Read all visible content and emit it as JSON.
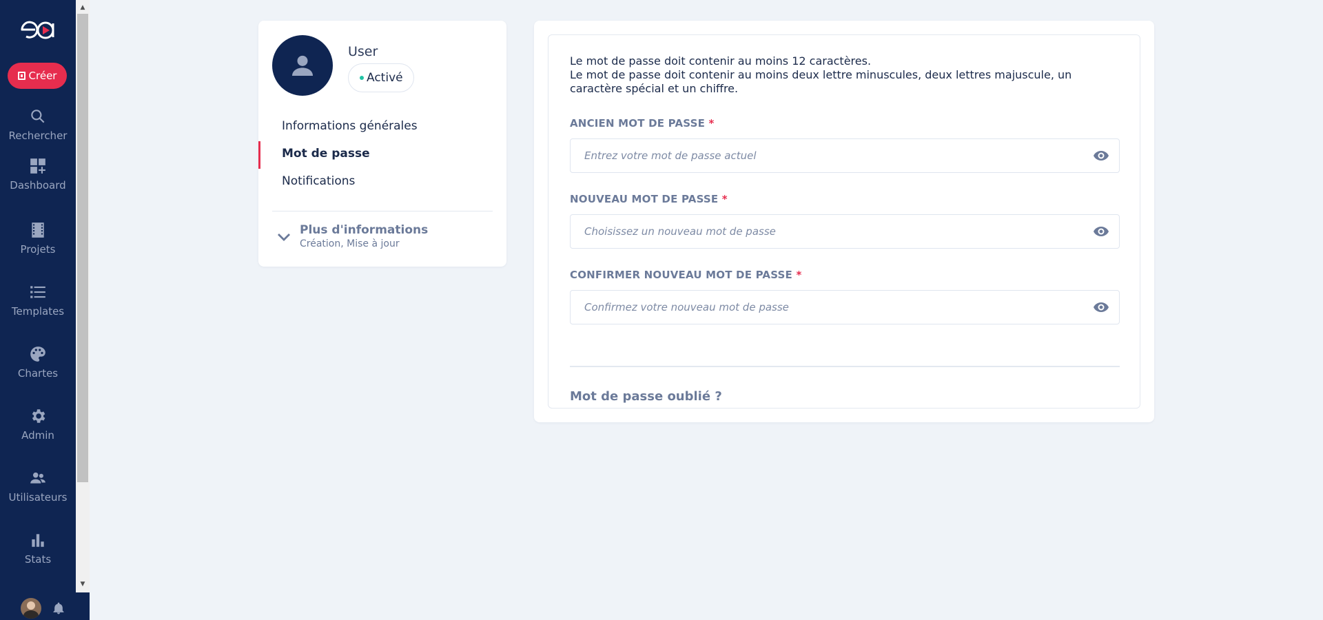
{
  "sidebar": {
    "logo_text": "ea",
    "create_label": "Créer",
    "items": [
      {
        "label": "Rechercher",
        "icon": "search-icon"
      },
      {
        "label": "Dashboard",
        "icon": "dashboard-icon"
      },
      {
        "label": "Projets",
        "icon": "film-icon"
      },
      {
        "label": "Templates",
        "icon": "list-icon"
      },
      {
        "label": "Chartes",
        "icon": "palette-icon"
      },
      {
        "label": "Admin",
        "icon": "gear-icon"
      },
      {
        "label": "Utilisateurs",
        "icon": "users-icon"
      },
      {
        "label": "Stats",
        "icon": "bar-chart-icon"
      }
    ],
    "bottom_icons": [
      "user-avatar",
      "bell-icon"
    ]
  },
  "profile": {
    "name": "User",
    "status": "Activé",
    "status_color": "#21c3a4",
    "menu": [
      {
        "label": "Informations générales",
        "active": false
      },
      {
        "label": "Mot de passe",
        "active": true
      },
      {
        "label": "Notifications",
        "active": false
      }
    ],
    "more": {
      "title": "Plus d'informations",
      "subtitle": "Création, Mise à jour"
    }
  },
  "password_form": {
    "rules_line1": "Le mot de passe doit contenir au moins 12 caractères.",
    "rules_line2": "Le mot de passe doit contenir au moins deux lettre minuscules, deux lettres majuscule, un caractère spécial et un chiffre.",
    "fields": [
      {
        "label": "ANCIEN MOT DE PASSE",
        "required_mark": "*",
        "placeholder": "Entrez votre mot de passe actuel",
        "value": ""
      },
      {
        "label": "NOUVEAU MOT DE PASSE",
        "required_mark": "*",
        "placeholder": "Choisissez un nouveau mot de passe",
        "value": ""
      },
      {
        "label": "CONFIRMER NOUVEAU MOT DE PASSE",
        "required_mark": "*",
        "placeholder": "Confirmez votre nouveau mot de passe",
        "value": ""
      }
    ],
    "forgot_label": "Mot de passe oublié ?"
  },
  "colors": {
    "sidebar_bg": "#0f2552",
    "accent": "#e62d4e",
    "page_bg": "#eff3f8"
  }
}
